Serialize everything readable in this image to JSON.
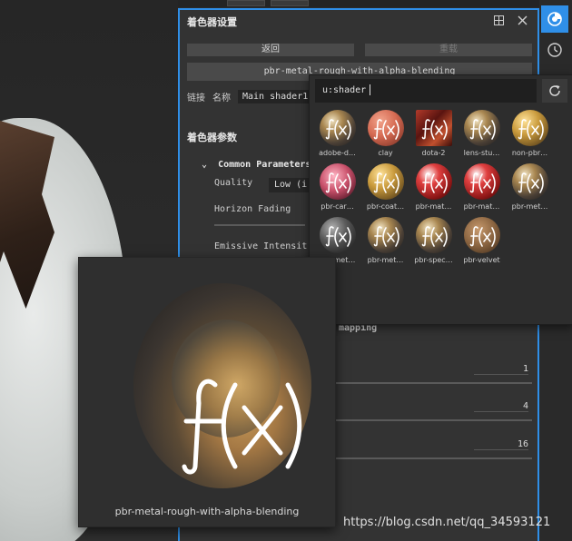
{
  "panel": {
    "title": "着色器设置",
    "back_label": "返回",
    "reset_label": "重载",
    "shader_name": "pbr-metal-rough-with-alpha-blending",
    "link_label": "链接",
    "name_label": "名称",
    "name_value": "Main shader1",
    "section_title": "着色器参数",
    "group_title": "Common Parameters",
    "quality_label": "Quality",
    "quality_value": "Low (i",
    "horizon_label": "Horizon Fading",
    "emissive_label": "Emissive Intensit",
    "mapping_label": "mapping",
    "values": [
      "1",
      "4",
      "16"
    ]
  },
  "popup": {
    "search_value": "u:shader",
    "items": [
      {
        "label": "adobe-d…",
        "style": "metal"
      },
      {
        "label": "clay",
        "style": "clay"
      },
      {
        "label": "dota-2",
        "style": "dota"
      },
      {
        "label": "lens-stu…",
        "style": "metal"
      },
      {
        "label": "non-pbr…",
        "style": "gold"
      },
      {
        "label": "pbr-car…",
        "style": "pink"
      },
      {
        "label": "pbr-coat…",
        "style": "gold"
      },
      {
        "label": "pbr-mat…",
        "style": "red"
      },
      {
        "label": "pbr-mat…",
        "style": "red"
      },
      {
        "label": "pbr-met…",
        "style": "metal"
      },
      {
        "label": "pbr-met…",
        "style": "dark"
      },
      {
        "label": "pbr-met…",
        "style": "metal"
      },
      {
        "label": "pbr-spec…",
        "style": "metal"
      },
      {
        "label": "pbr-velvet",
        "style": "velvet"
      }
    ]
  },
  "preview": {
    "caption": "pbr-metal-rough-with-alpha-blending"
  },
  "watermark": "https://blog.csdn.net/qq_34593121",
  "icons": {
    "maximize": "maximize-icon",
    "close": "close-icon",
    "shader": "shader-icon",
    "history": "history-icon",
    "refresh": "refresh-icon"
  },
  "colors": {
    "accent": "#2f8fe8",
    "panel_bg": "#333333"
  }
}
